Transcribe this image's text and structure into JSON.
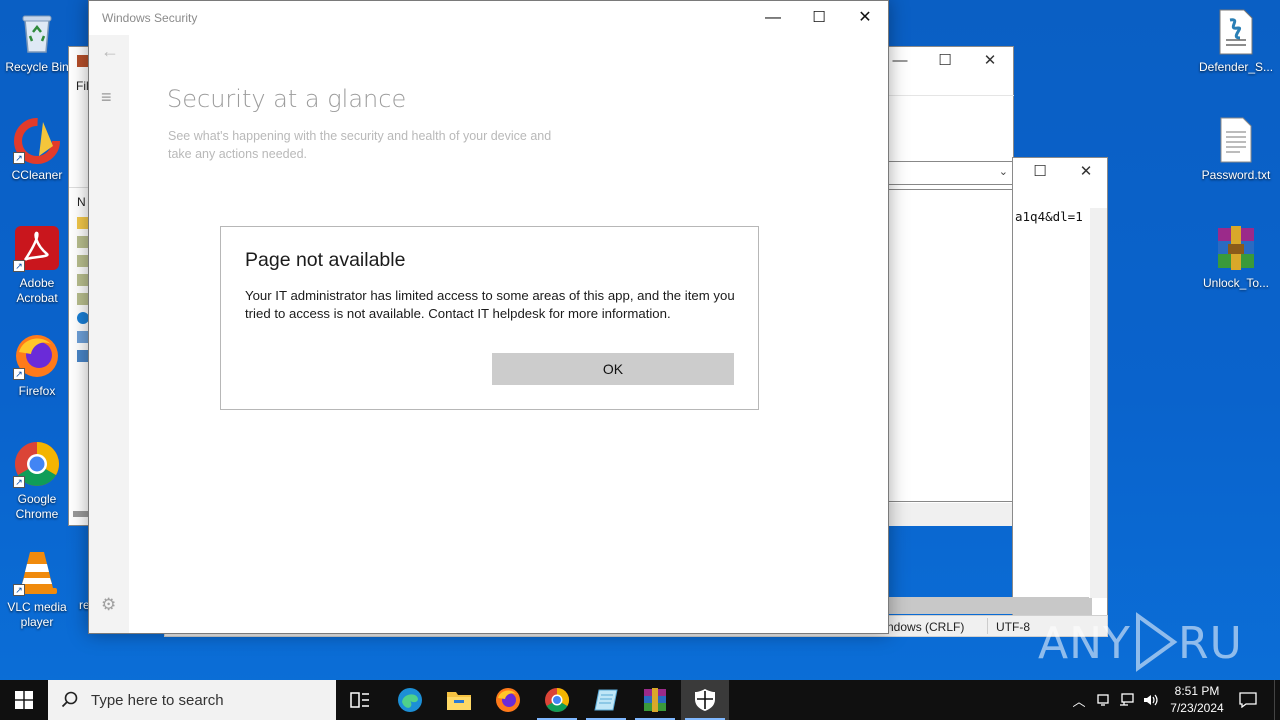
{
  "desktop": {
    "icons_left": [
      {
        "label": "Recycle Bin",
        "icon": "recycle-bin-icon"
      },
      {
        "label": "CCleaner",
        "icon": "ccleaner-icon"
      },
      {
        "label": "Adobe Acrobat",
        "icon": "adobe-acrobat-icon"
      },
      {
        "label": "Firefox",
        "icon": "firefox-icon"
      },
      {
        "label": "Google Chrome",
        "icon": "chrome-icon"
      },
      {
        "label": "VLC media player",
        "icon": "vlc-icon"
      }
    ],
    "icons_right": [
      {
        "label": "Defender_S...",
        "icon": "script-file-icon"
      },
      {
        "label": "Password.txt",
        "icon": "text-file-icon"
      },
      {
        "label": "Unlock_To...",
        "icon": "winrar-archive-icon"
      }
    ],
    "partial_label": "re"
  },
  "background_windows": {
    "explorer_menu_fragment": "Fil",
    "explorer_column_fragment": "N",
    "notepad_text_fragment": "a1q4&dl=1",
    "notepad_status_encoding": "ndows (CRLF)",
    "notepad_status_charset": "UTF-8"
  },
  "security_window": {
    "title": "Windows Security",
    "heading": "Security at a glance",
    "subheading": "See what's happening with the security and health of your device and take any actions needed."
  },
  "dialog": {
    "title": "Page not available",
    "message": "Your IT administrator has limited access to some areas of this app, and the item you tried to access is not available. Contact IT helpdesk for more information.",
    "ok_label": "OK"
  },
  "taskbar": {
    "search_placeholder": "Type here to search",
    "time": "8:51 PM",
    "date": "7/23/2024"
  },
  "watermark": "ANY RUN",
  "colors": {
    "desktop": "#0a63cc",
    "taskbar": "#101010",
    "ok_button": "#cccccc",
    "active_task": "#3a3a3a"
  }
}
